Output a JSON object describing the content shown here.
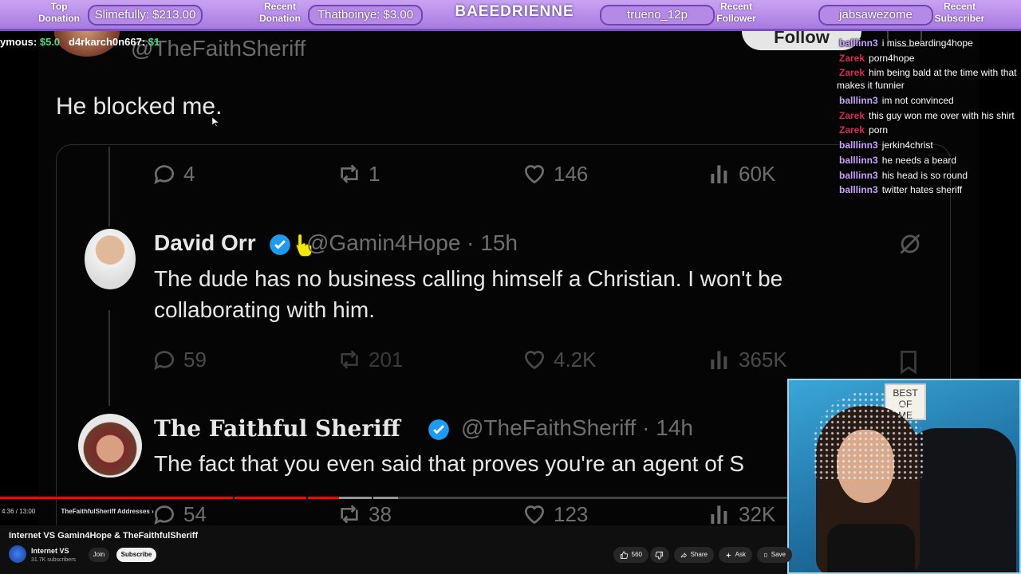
{
  "stream_bar": {
    "top_donation_label": "Top\nDonation",
    "top_donation_value": "Slimefully: $213.00",
    "recent_donation_label": "Recent\nDonation",
    "recent_donation_value": "Thatboinye: $3.00",
    "streamer_name": "BAEEDRIENNE",
    "recent_follower_value": "trueno_12p",
    "recent_follower_label": "Recent\nFollower",
    "recent_subscriber_value": "jabsawezome",
    "recent_subscriber_label": "Recent\nSubscriber",
    "accent_color": "#a77be0"
  },
  "ticker": {
    "name1": "ymous:",
    "amount1": "$5.0",
    "name2": "d4rkarch0n667:",
    "amount2": "$1"
  },
  "tweet_top": {
    "handle": "@TheFaithSheriff",
    "follow_label": "Follow",
    "text": "He blocked me.",
    "stats": {
      "replies": "4",
      "retweets": "1",
      "likes": "146",
      "views": "60K"
    }
  },
  "reply1": {
    "name": "David Orr",
    "handle_time": "@Gamin4Hope · 15h",
    "text": "The dude has no business calling himself a Christian. I won't be collaborating with him.",
    "stats": {
      "replies": "59",
      "retweets": "201",
      "likes": "4.2K",
      "views": "365K"
    }
  },
  "reply2": {
    "name": "The Faithful Sheriff",
    "handle_time": "@TheFaithSheriff · 14h",
    "text": "The fact that you even said that proves you're an agent of S",
    "stats": {
      "replies": "54",
      "retweets": "38",
      "likes": "123",
      "views": "32K"
    }
  },
  "player": {
    "progress_fraction": 0.332,
    "buffer_fraction": 0.39,
    "time": "4:36 / 13:00",
    "chapter": "TheFaithfulSheriff Addresses ›"
  },
  "chat": [
    {
      "user": "balllinn3",
      "color": "#c8a2ff",
      "text": "i miss bearding4hope"
    },
    {
      "user": "Zarek",
      "color": "#e0245e",
      "text": "porn4hope"
    },
    {
      "user": "Zarek",
      "color": "#e0245e",
      "text": "him being bald at the time with that makes it funnier"
    },
    {
      "user": "balllinn3",
      "color": "#c8a2ff",
      "text": "im not convinced"
    },
    {
      "user": "Zarek",
      "color": "#e0245e",
      "text": "this guy won me over with his shirt"
    },
    {
      "user": "Zarek",
      "color": "#e0245e",
      "text": "porn"
    },
    {
      "user": "balllinn3",
      "color": "#c8a2ff",
      "text": "jerkin4christ"
    },
    {
      "user": "balllinn3",
      "color": "#c8a2ff",
      "text": "he needs a beard"
    },
    {
      "user": "balllinn3",
      "color": "#c8a2ff",
      "text": "his head is so round"
    },
    {
      "user": "balllinn3",
      "color": "#c8a2ff",
      "text": "twitter hates sheriff"
    }
  ],
  "webcam": {
    "sign_text": "BEST\nOF\nME"
  },
  "youtube": {
    "title": "Internet VS Gamin4Hope & TheFaithfulSheriff",
    "channel": "Internet VS",
    "subscribers": "31.7K subscribers",
    "join_label": "Join",
    "subscribe_label": "Subscribe",
    "likes": "560",
    "share_label": "Share",
    "ask_label": "Ask",
    "save_label": "Save"
  }
}
